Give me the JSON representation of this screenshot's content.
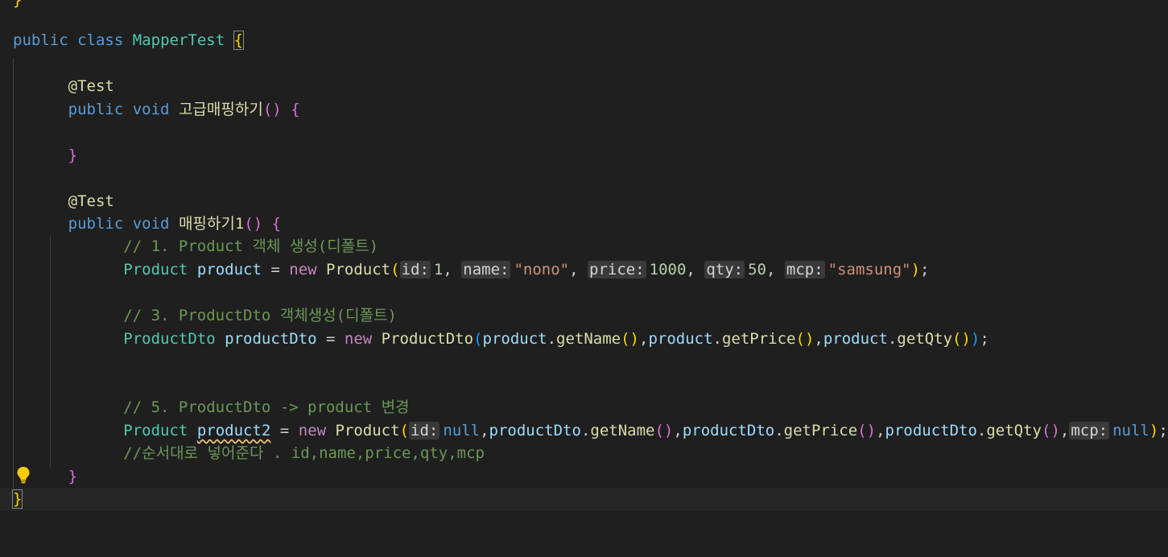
{
  "editor": {
    "lines": {
      "l0": {
        "brace": "}"
      },
      "l1": {
        "kw_public": "public",
        "kw_class": "class",
        "class_name": "MapperTest",
        "brace": "{"
      },
      "l3": {
        "annotation": "@Test"
      },
      "l4": {
        "kw_public": "public",
        "kw_void": "void",
        "method_name": "고급매핑하기",
        "parens": "()",
        "brace": "{"
      },
      "l6": {
        "brace": "}"
      },
      "l8": {
        "annotation": "@Test"
      },
      "l9": {
        "kw_public": "public",
        "kw_void": "void",
        "method_name": "매핑하기1",
        "parens": "()",
        "brace": "{"
      },
      "l10": {
        "comment": "// 1. Product 객체 생성(디폴트)"
      },
      "l11": {
        "type": "Product",
        "var": "product",
        "eq": "=",
        "kw_new": "new",
        "ctor": "Product",
        "open": "(",
        "hint_id": "id:",
        "v_id": "1",
        "c1": ",",
        "hint_name": "name:",
        "v_name": "\"nono\"",
        "c2": ",",
        "hint_price": "price:",
        "v_price": "1000",
        "c3": ",",
        "hint_qty": "qty:",
        "v_qty": "50",
        "c4": ",",
        "hint_mcp": "mcp:",
        "v_mcp": "\"samsung\"",
        "close": ")",
        "semi": ";"
      },
      "l13": {
        "comment": "// 3. ProductDto 객체생성(디폴트)"
      },
      "l14": {
        "type": "ProductDto",
        "var": "productDto",
        "eq": "=",
        "kw_new": "new",
        "ctor": "ProductDto",
        "open": "(",
        "obj1": "product",
        "m1": "getName",
        "p1": "()",
        "c1": ",",
        "obj2": "product",
        "m2": "getPrice",
        "p2": "()",
        "c2": ",",
        "obj3": "product",
        "m3": "getQty",
        "p3": "()",
        "close": ")",
        "semi": ";"
      },
      "l17": {
        "comment": "// 5. ProductDto -> product 변경"
      },
      "l18": {
        "type": "Product",
        "var": "product2",
        "eq": "=",
        "kw_new": "new",
        "ctor": "Product",
        "open": "(",
        "hint_id": "id:",
        "v_id": "null",
        "c1": ",",
        "obj1": "productDto",
        "m1": "getName",
        "p1": "()",
        "c2": ",",
        "obj2": "productDto",
        "m2": "getPrice",
        "p2": "()",
        "c3": ",",
        "obj3": "productDto",
        "m3": "getQty",
        "p3": "()",
        "c4": ",",
        "hint_mcp": "mcp:",
        "v_mcp": "null",
        "close": ")",
        "semi": ";"
      },
      "l19": {
        "comment": "//순서대로 넣어준다 . id,name,price,qty,mcp"
      },
      "l20": {
        "brace": "}"
      },
      "l21": {
        "brace": "}"
      }
    },
    "icons": {
      "lightbulb": "lightbulb-icon"
    }
  }
}
